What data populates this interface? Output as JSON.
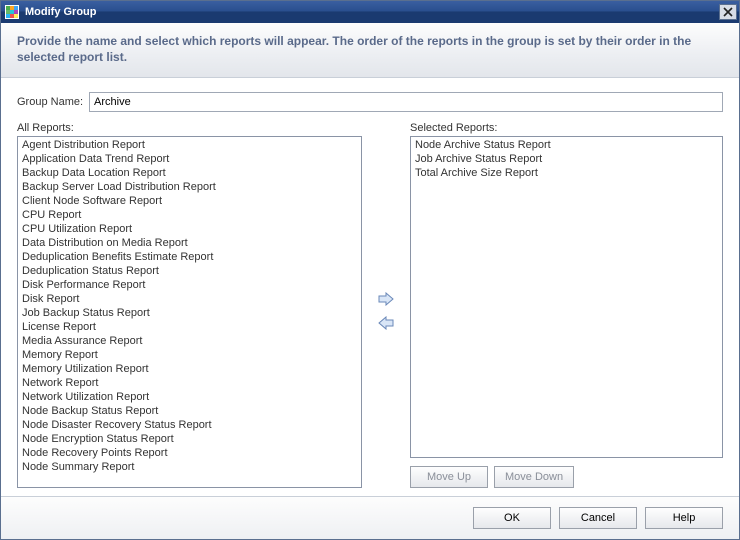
{
  "window": {
    "title": "Modify Group"
  },
  "instruction": "Provide the name and select which reports will appear.  The order of the reports in the group is set by their order in the selected report list.",
  "group_name": {
    "label": "Group Name:",
    "value": "Archive"
  },
  "all_reports": {
    "label": "All Reports:",
    "items": [
      "Agent Distribution Report",
      "Application Data Trend Report",
      "Backup Data Location Report",
      "Backup Server Load Distribution Report",
      "Client Node Software Report",
      "CPU Report",
      "CPU Utilization Report",
      "Data Distribution on Media Report",
      "Deduplication Benefits Estimate Report",
      "Deduplication Status Report",
      "Disk Performance Report",
      "Disk Report",
      "Job Backup Status Report",
      "License Report",
      "Media Assurance Report",
      "Memory Report",
      "Memory Utilization Report",
      "Network Report",
      "Network Utilization Report",
      "Node Backup Status Report",
      "Node Disaster Recovery Status Report",
      "Node Encryption Status Report",
      "Node Recovery Points Report",
      "Node Summary Report"
    ]
  },
  "selected_reports": {
    "label": "Selected Reports:",
    "items": [
      "Node Archive Status Report",
      "Job Archive Status Report",
      "Total Archive Size Report"
    ]
  },
  "buttons": {
    "move_up": "Move Up",
    "move_down": "Move Down",
    "ok": "OK",
    "cancel": "Cancel",
    "help": "Help"
  }
}
